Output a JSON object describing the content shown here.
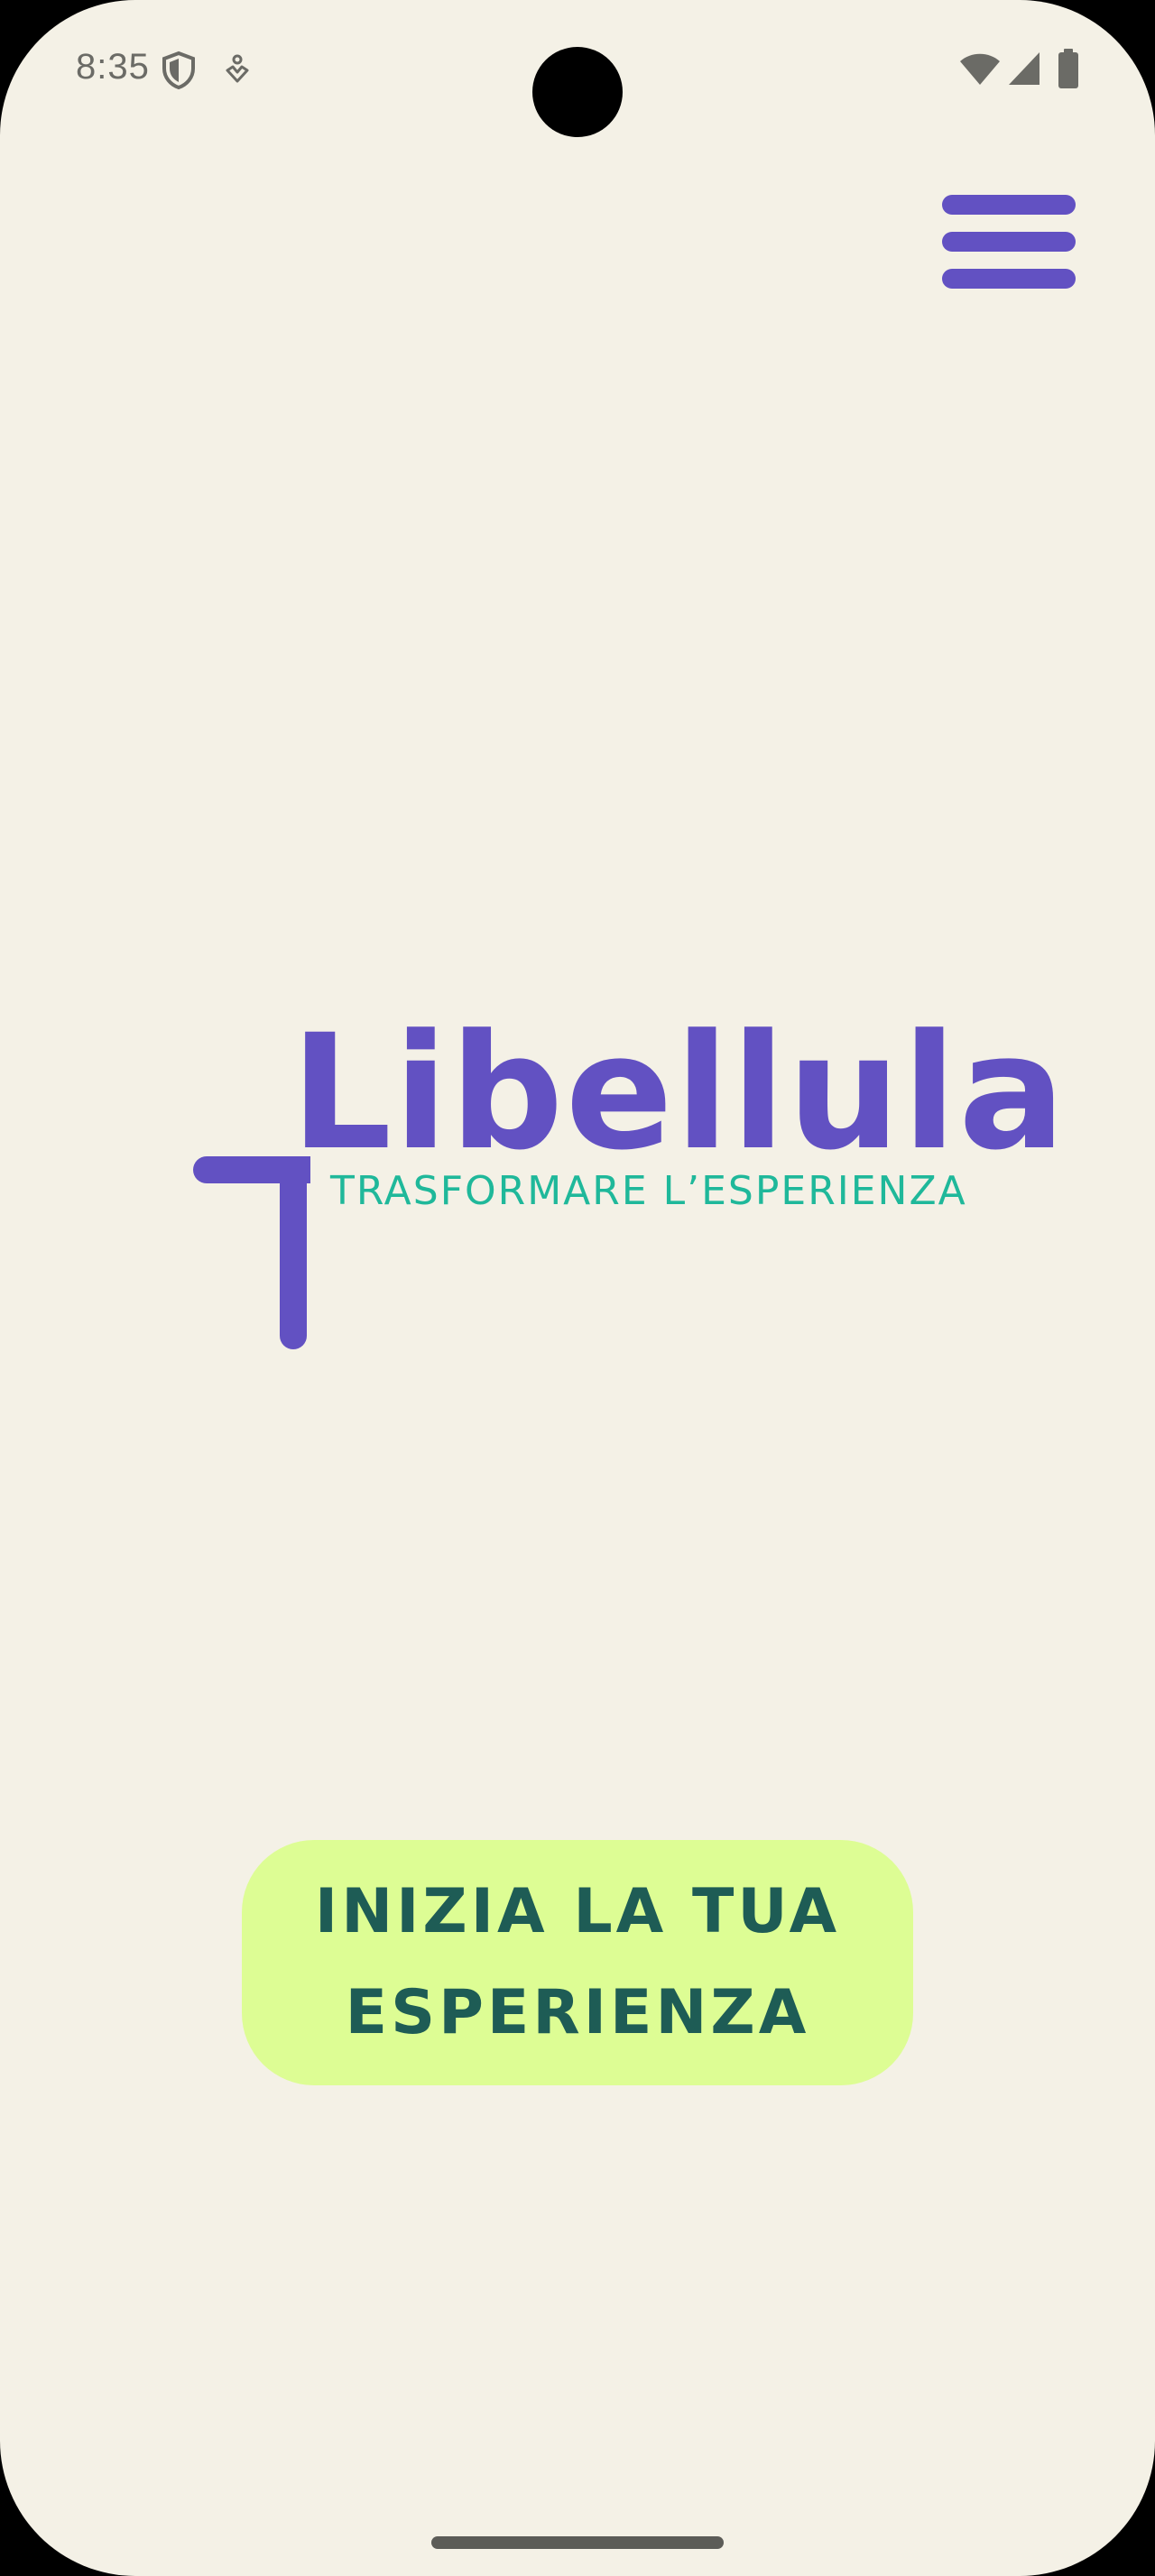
{
  "status_bar": {
    "time": "8:35",
    "icons": [
      "shield-icon",
      "accessibility-icon",
      "wifi-icon",
      "signal-icon",
      "battery-icon"
    ]
  },
  "header": {
    "menu_icon": "hamburger-menu-icon"
  },
  "logo": {
    "name": "Libellula",
    "tagline": "TRASFORMARE L’ESPERIENZA"
  },
  "cta": {
    "label": "INIZIA LA TUA ESPERIENZA"
  },
  "colors": {
    "background": "#f4f1e6",
    "brand_purple": "#6251c2",
    "brand_teal": "#1fb89a",
    "cta_background": "#ddfd94",
    "cta_text": "#1e5c55"
  }
}
